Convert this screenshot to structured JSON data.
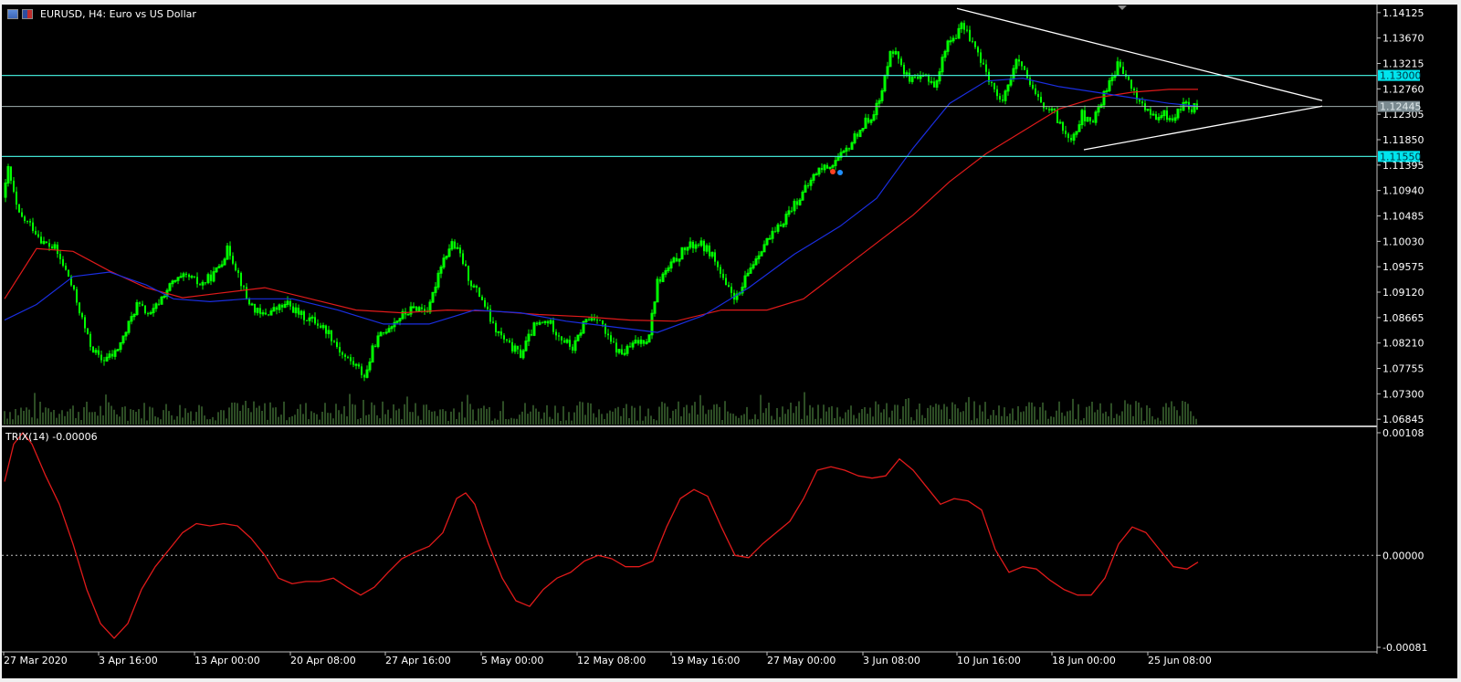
{
  "window": {
    "title": "EURUSD, H4:  Euro vs US Dollar",
    "icon_names": [
      "chart-window-icon",
      "eu-us-flag-icon"
    ]
  },
  "colors": {
    "background": "#000000",
    "bull_candle": "#00ff00",
    "grid": "#c0c0c0",
    "level_line": "#40e0d0",
    "ma_fast": "#1a2ee0",
    "ma_slow": "#e01a1a",
    "trix": "#e01a1a",
    "volume": "#5a9a4a",
    "triangle": "#ffffff",
    "level_badge": "#00e5ee",
    "price_badge": "#7a8a90"
  },
  "chart_data": [
    {
      "type": "candlestick",
      "symbol": "EURUSD",
      "timeframe": "H4",
      "title": "EURUSD, H4:  Euro vs US Dollar",
      "y_ticks": [
        "1.14125",
        "1.13670",
        "1.13215",
        "1.12760",
        "1.12305",
        "1.11850",
        "1.11395",
        "1.10940",
        "1.10485",
        "1.10030",
        "1.09575",
        "1.09120",
        "1.08665",
        "1.08210",
        "1.07755",
        "1.07300",
        "1.06845"
      ],
      "ylim": [
        1.0675,
        1.1422
      ],
      "x_ticks": [
        "27 Mar 2020",
        "3 Apr 16:00",
        "13 Apr 00:00",
        "20 Apr 08:00",
        "27 Apr 16:00",
        "5 May 00:00",
        "12 May 08:00",
        "19 May 16:00",
        "27 May 00:00",
        "3 Jun 08:00",
        "10 Jun 16:00",
        "18 Jun 00:00",
        "25 Jun 08:00"
      ],
      "close_path": [
        [
          0,
          1.0985
        ],
        [
          8,
          1.114
        ],
        [
          20,
          1.105
        ],
        [
          35,
          1.103
        ],
        [
          48,
          1.1
        ],
        [
          60,
          1.099
        ],
        [
          75,
          1.094
        ],
        [
          85,
          1.089
        ],
        [
          98,
          1.082
        ],
        [
          110,
          1.079
        ],
        [
          125,
          1.08
        ],
        [
          135,
          1.083
        ],
        [
          150,
          1.089
        ],
        [
          165,
          1.087
        ],
        [
          180,
          1.091
        ],
        [
          190,
          1.093
        ],
        [
          205,
          1.094
        ],
        [
          220,
          1.0925
        ],
        [
          235,
          1.0945
        ],
        [
          250,
          1.099
        ],
        [
          260,
          1.095
        ],
        [
          270,
          1.09
        ],
        [
          285,
          1.087
        ],
        [
          300,
          1.088
        ],
        [
          315,
          1.089
        ],
        [
          330,
          1.087
        ],
        [
          345,
          1.086
        ],
        [
          360,
          1.084
        ],
        [
          375,
          1.08
        ],
        [
          390,
          1.078
        ],
        [
          400,
          1.076
        ],
        [
          410,
          1.082
        ],
        [
          425,
          1.085
        ],
        [
          440,
          1.087
        ],
        [
          455,
          1.0885
        ],
        [
          470,
          1.088
        ],
        [
          482,
          1.096
        ],
        [
          495,
          1.1
        ],
        [
          505,
          1.0975
        ],
        [
          515,
          1.093
        ],
        [
          528,
          1.09
        ],
        [
          540,
          1.085
        ],
        [
          555,
          1.082
        ],
        [
          570,
          1.08
        ],
        [
          585,
          1.085
        ],
        [
          600,
          1.086
        ],
        [
          615,
          1.083
        ],
        [
          628,
          1.081
        ],
        [
          640,
          1.086
        ],
        [
          655,
          1.087
        ],
        [
          665,
          1.083
        ],
        [
          680,
          1.08
        ],
        [
          695,
          1.082
        ],
        [
          710,
          1.083
        ],
        [
          720,
          1.093
        ],
        [
          735,
          1.096
        ],
        [
          750,
          1.099
        ],
        [
          765,
          1.1
        ],
        [
          780,
          1.098
        ],
        [
          795,
          1.092
        ],
        [
          808,
          1.09
        ],
        [
          820,
          1.095
        ],
        [
          835,
          1.0995
        ],
        [
          850,
          1.102
        ],
        [
          865,
          1.106
        ],
        [
          880,
          1.109
        ],
        [
          895,
          1.113
        ],
        [
          910,
          1.114
        ],
        [
          925,
          1.116
        ],
        [
          940,
          1.12
        ],
        [
          955,
          1.123
        ],
        [
          965,
          1.126
        ],
        [
          975,
          1.135
        ],
        [
          985,
          1.133
        ],
        [
          995,
          1.129
        ],
        [
          1005,
          1.129
        ],
        [
          1015,
          1.13
        ],
        [
          1025,
          1.128
        ],
        [
          1035,
          1.135
        ],
        [
          1045,
          1.137
        ],
        [
          1055,
          1.139
        ],
        [
          1065,
          1.136
        ],
        [
          1075,
          1.132
        ],
        [
          1085,
          1.129
        ],
        [
          1095,
          1.125
        ],
        [
          1105,
          1.129
        ],
        [
          1115,
          1.133
        ],
        [
          1125,
          1.129
        ],
        [
          1135,
          1.126
        ],
        [
          1145,
          1.124
        ],
        [
          1155,
          1.123
        ],
        [
          1165,
          1.12
        ],
        [
          1175,
          1.119
        ],
        [
          1185,
          1.123
        ],
        [
          1195,
          1.121
        ],
        [
          1205,
          1.125
        ],
        [
          1215,
          1.129
        ],
        [
          1225,
          1.132
        ],
        [
          1235,
          1.129
        ],
        [
          1245,
          1.126
        ],
        [
          1255,
          1.124
        ],
        [
          1265,
          1.122
        ],
        [
          1275,
          1.123
        ],
        [
          1285,
          1.122
        ],
        [
          1295,
          1.125
        ],
        [
          1305,
          1.124
        ],
        [
          1312,
          1.1245
        ]
      ],
      "ma_fast": [
        [
          5,
          1.0862
        ],
        [
          40,
          1.089
        ],
        [
          80,
          1.094
        ],
        [
          120,
          1.0948
        ],
        [
          160,
          1.0925
        ],
        [
          190,
          1.09
        ],
        [
          230,
          1.0895
        ],
        [
          270,
          1.09
        ],
        [
          320,
          1.09
        ],
        [
          370,
          1.088
        ],
        [
          420,
          1.0855
        ],
        [
          470,
          1.0855
        ],
        [
          520,
          1.088
        ],
        [
          570,
          1.0875
        ],
        [
          620,
          1.086
        ],
        [
          670,
          1.085
        ],
        [
          720,
          1.084
        ],
        [
          770,
          1.087
        ],
        [
          820,
          1.092
        ],
        [
          870,
          1.098
        ],
        [
          920,
          1.103
        ],
        [
          960,
          1.108
        ],
        [
          1000,
          1.117
        ],
        [
          1040,
          1.125
        ],
        [
          1080,
          1.129
        ],
        [
          1120,
          1.1295
        ],
        [
          1160,
          1.128
        ],
        [
          1200,
          1.127
        ],
        [
          1240,
          1.126
        ],
        [
          1280,
          1.125
        ],
        [
          1312,
          1.1245
        ]
      ],
      "ma_slow": [
        [
          5,
          1.09
        ],
        [
          40,
          1.099
        ],
        [
          80,
          1.0985
        ],
        [
          120,
          1.095
        ],
        [
          160,
          1.092
        ],
        [
          200,
          1.0902
        ],
        [
          240,
          1.091
        ],
        [
          290,
          1.092
        ],
        [
          340,
          1.09
        ],
        [
          390,
          1.088
        ],
        [
          440,
          1.0875
        ],
        [
          490,
          1.088
        ],
        [
          540,
          1.0878
        ],
        [
          590,
          1.0872
        ],
        [
          640,
          1.0868
        ],
        [
          690,
          1.0862
        ],
        [
          740,
          1.086
        ],
        [
          790,
          1.088
        ],
        [
          840,
          1.088
        ],
        [
          880,
          1.09
        ],
        [
          920,
          1.095
        ],
        [
          960,
          1.1
        ],
        [
          1000,
          1.105
        ],
        [
          1040,
          1.111
        ],
        [
          1080,
          1.116
        ],
        [
          1120,
          1.12
        ],
        [
          1160,
          1.124
        ],
        [
          1200,
          1.126
        ],
        [
          1240,
          1.127
        ],
        [
          1280,
          1.1275
        ],
        [
          1312,
          1.1275
        ]
      ],
      "levels": [
        {
          "name": "upper-level-line",
          "value": 1.13,
          "label": "1.13000"
        },
        {
          "name": "lower-level-line",
          "value": 1.1155,
          "label": "1.11550"
        }
      ],
      "current_price": {
        "value": 1.12445,
        "label": "1.12445"
      },
      "triangle_upper": [
        [
          1048,
          1.142
        ],
        [
          1448,
          1.1255
        ]
      ],
      "triangle_lower": [
        [
          1187,
          1.1167
        ],
        [
          1448,
          1.1245
        ]
      ]
    },
    {
      "type": "line",
      "title": "TRIX(14) -0.00006",
      "y_ticks": [
        "0.00108",
        "0.00000",
        "-0.00081"
      ],
      "ylim": [
        -0.00081,
        0.00108
      ],
      "zero_line": 0.0,
      "series": [
        {
          "name": "TRIX(14)",
          "values": [
            [
              5,
              0.00065
            ],
            [
              15,
              0.00098
            ],
            [
              25,
              0.00108
            ],
            [
              35,
              0.00098
            ],
            [
              50,
              0.0007
            ],
            [
              65,
              0.00045
            ],
            [
              80,
              0.0001
            ],
            [
              95,
              -0.0003
            ],
            [
              110,
              -0.0006
            ],
            [
              125,
              -0.00073
            ],
            [
              140,
              -0.0006
            ],
            [
              155,
              -0.0003
            ],
            [
              170,
              -0.0001
            ],
            [
              185,
              5e-05
            ],
            [
              200,
              0.0002
            ],
            [
              215,
              0.00028
            ],
            [
              230,
              0.00026
            ],
            [
              245,
              0.00028
            ],
            [
              260,
              0.00026
            ],
            [
              275,
              0.00015
            ],
            [
              290,
              0.0
            ],
            [
              305,
              -0.0002
            ],
            [
              320,
              -0.00025
            ],
            [
              335,
              -0.00023
            ],
            [
              350,
              -0.00023
            ],
            [
              365,
              -0.0002
            ],
            [
              380,
              -0.00028
            ],
            [
              395,
              -0.00035
            ],
            [
              410,
              -0.00028
            ],
            [
              425,
              -0.00015
            ],
            [
              440,
              -3e-05
            ],
            [
              455,
              3e-05
            ],
            [
              470,
              8e-05
            ],
            [
              485,
              0.0002
            ],
            [
              500,
              0.0005
            ],
            [
              510,
              0.00055
            ],
            [
              520,
              0.00045
            ],
            [
              535,
              0.0001
            ],
            [
              550,
              -0.0002
            ],
            [
              565,
              -0.0004
            ],
            [
              580,
              -0.00045
            ],
            [
              595,
              -0.0003
            ],
            [
              610,
              -0.0002
            ],
            [
              625,
              -0.00015
            ],
            [
              640,
              -5e-05
            ],
            [
              655,
              0.0
            ],
            [
              670,
              -3e-05
            ],
            [
              685,
              -0.0001
            ],
            [
              700,
              -0.0001
            ],
            [
              715,
              -5e-05
            ],
            [
              730,
              0.00025
            ],
            [
              745,
              0.0005
            ],
            [
              760,
              0.00058
            ],
            [
              775,
              0.00052
            ],
            [
              790,
              0.00025
            ],
            [
              805,
              0.0
            ],
            [
              820,
              -2e-05
            ],
            [
              835,
              0.0001
            ],
            [
              850,
              0.0002
            ],
            [
              865,
              0.0003
            ],
            [
              880,
              0.0005
            ],
            [
              895,
              0.00075
            ],
            [
              910,
              0.00078
            ],
            [
              925,
              0.00075
            ],
            [
              940,
              0.0007
            ],
            [
              955,
              0.00068
            ],
            [
              970,
              0.0007
            ],
            [
              985,
              0.00085
            ],
            [
              1000,
              0.00075
            ],
            [
              1015,
              0.0006
            ],
            [
              1030,
              0.00045
            ],
            [
              1045,
              0.0005
            ],
            [
              1060,
              0.00048
            ],
            [
              1075,
              0.0004
            ],
            [
              1090,
              5e-05
            ],
            [
              1105,
              -0.00015
            ],
            [
              1120,
              -0.0001
            ],
            [
              1135,
              -0.00012
            ],
            [
              1150,
              -0.00022
            ],
            [
              1165,
              -0.0003
            ],
            [
              1180,
              -0.00035
            ],
            [
              1195,
              -0.00035
            ],
            [
              1210,
              -0.0002
            ],
            [
              1225,
              0.0001
            ],
            [
              1240,
              0.00025
            ],
            [
              1255,
              0.0002
            ],
            [
              1270,
              5e-05
            ],
            [
              1285,
              -0.0001
            ],
            [
              1300,
              -0.00012
            ],
            [
              1312,
              -6e-05
            ]
          ]
        }
      ]
    }
  ]
}
